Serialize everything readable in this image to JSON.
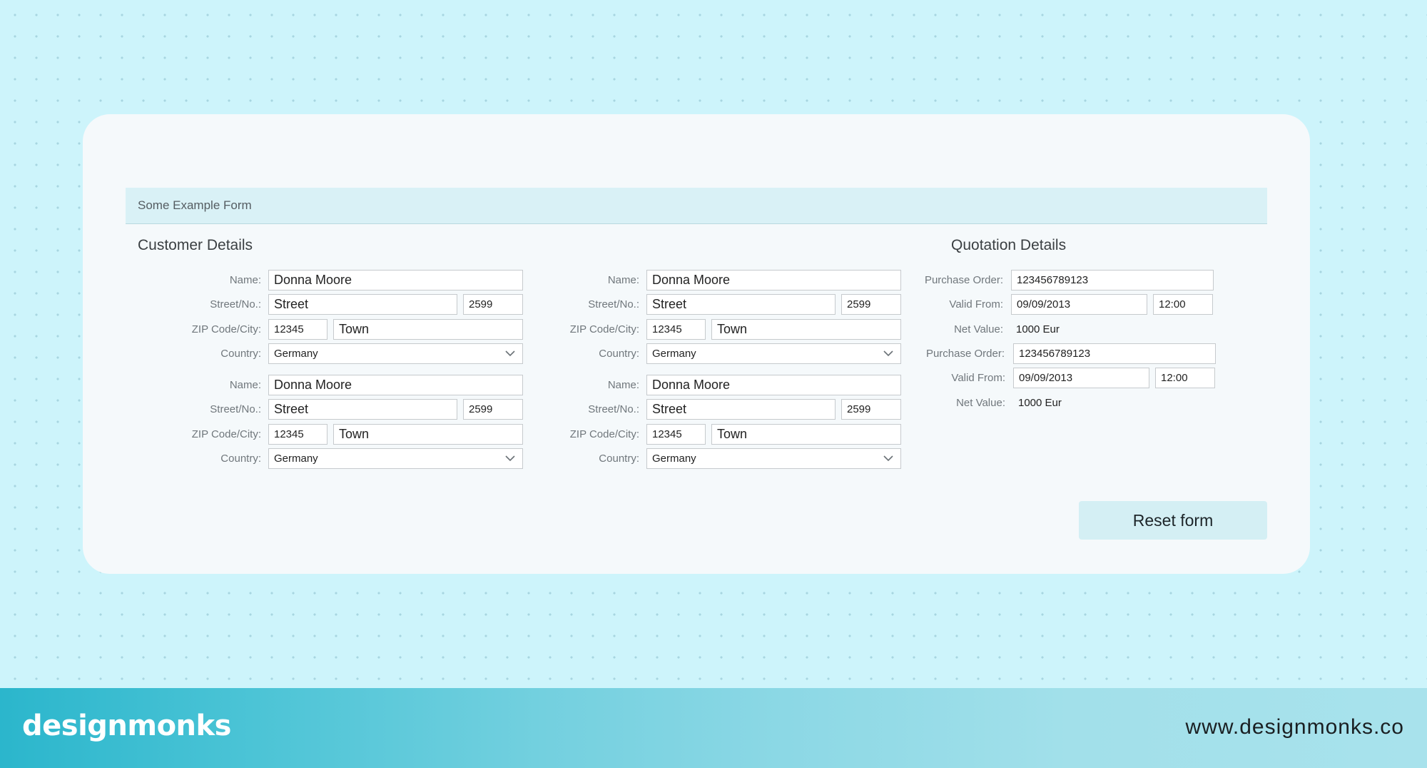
{
  "form": {
    "title": "Some Example Form",
    "customer_section_title": "Customer Details",
    "quotation_section_title": "Quotation Details",
    "labels": {
      "name": "Name:",
      "street": "Street/No.:",
      "zip": "ZIP Code/City:",
      "country": "Country:",
      "purchase_order": "Purchase Order:",
      "valid_from": "Valid From:",
      "net_value": "Net Value:"
    },
    "customers": [
      {
        "name": "Donna Moore",
        "street": "Street",
        "number": "2599",
        "zip": "12345",
        "city": "Town",
        "country": "Germany"
      },
      {
        "name": "Donna Moore",
        "street": "Street",
        "number": "2599",
        "zip": "12345",
        "city": "Town",
        "country": "Germany"
      },
      {
        "name": "Donna Moore",
        "street": "Street",
        "number": "2599",
        "zip": "12345",
        "city": "Town",
        "country": "Germany"
      },
      {
        "name": "Donna Moore",
        "street": "Street",
        "number": "2599",
        "zip": "12345",
        "city": "Town",
        "country": "Germany"
      }
    ],
    "quotations": [
      {
        "purchase_order": "123456789123",
        "valid_date": "09/09/2013",
        "valid_time": "12:00",
        "net_value": "1000 Eur"
      },
      {
        "purchase_order": "123456789123",
        "valid_date": "09/09/2013",
        "valid_time": "12:00",
        "net_value": "1000 Eur"
      }
    ],
    "reset_label": "Reset form"
  },
  "footer": {
    "brand": "designmonks",
    "website": "www.designmonks.co"
  },
  "colors": {
    "background": "#cdf4fb",
    "card": "#f5f9fb",
    "header_band": "#d9f1f6",
    "button": "#d4eff4"
  },
  "icons": [
    "chevron-down-icon"
  ]
}
